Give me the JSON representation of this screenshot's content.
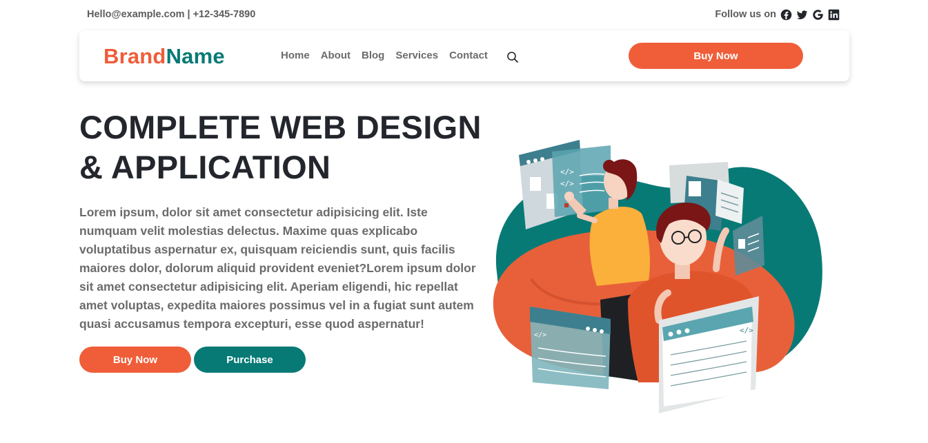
{
  "topbar": {
    "contact": "Hello@example.com | +12-345-7890",
    "follow_label": "Follow us on",
    "social_icons": [
      "facebook-icon",
      "twitter-icon",
      "google-icon",
      "linkedin-icon"
    ]
  },
  "header": {
    "brand_part1": "Brand",
    "brand_part2": "Name",
    "nav": [
      "Home",
      "About",
      "Blog",
      "Services",
      "Contact"
    ],
    "search_icon": "search-icon",
    "buy_label": "Buy Now"
  },
  "hero": {
    "title_line1": "COMPLETE WEB DESIGN",
    "title_line2": "& APPLICATION",
    "text": "Lorem ipsum, dolor sit amet consectetur adipisicing elit. Iste numquam velit molestias delectus. Maxime quas explicabo voluptatibus aspernatur ex, quisquam reiciendis sunt, quis facilis maiores dolor, dolorum aliquid provident eveniet?Lorem ipsum dolor sit amet consectetur adipisicing elit. Aperiam eligendi, hic repellat amet voluptas, expedita maiores possimus vel in a fugiat sunt autem quasi accusamus tempora excepturi, esse quod aspernatur!",
    "buy_label": "Buy Now",
    "purchase_label": "Purchase"
  },
  "illustration": {
    "code_symbol": "</>"
  },
  "colors": {
    "accent": "#ef5e39",
    "brand_teal": "#087a76",
    "heading": "#23262c",
    "body_text": "#6b6b6b",
    "mustard": "#fbb03b"
  }
}
